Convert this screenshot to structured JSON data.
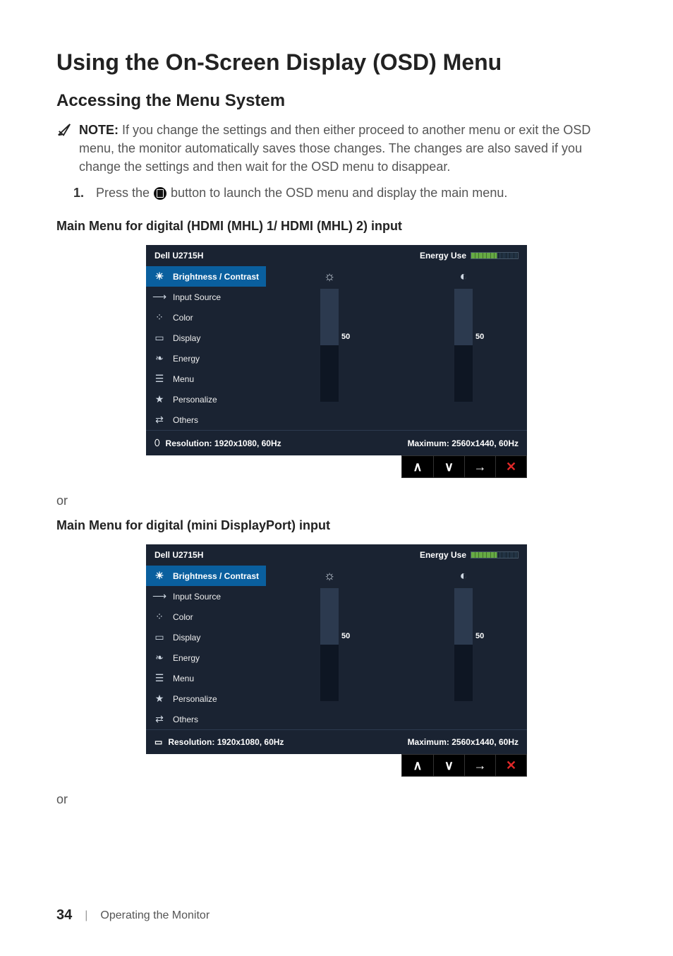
{
  "headings": {
    "h1": "Using the On-Screen Display (OSD) Menu",
    "h2": "Accessing the Menu System",
    "noteLabel": "NOTE:",
    "noteBody": " If you change the settings and then either proceed to another menu or exit the OSD menu, the monitor automatically saves those changes. The changes are also saved if you change the settings and then wait for the OSD menu to disappear.",
    "stepNum": "1.",
    "stepPre": "Press the ",
    "stepPost": " button to launch the OSD menu and display the main menu.",
    "sub1": "Main Menu for digital (HDMI (MHL) 1/ HDMI (MHL) 2) input",
    "or": "or",
    "sub2": "Main Menu for digital (mini DisplayPort) input"
  },
  "osd": {
    "model": "Dell U2715H",
    "energyLabel": "Energy Use",
    "menu": [
      {
        "icon": "☀",
        "label": "Brightness / Contrast",
        "selected": true
      },
      {
        "icon": "⟶",
        "label": "Input Source"
      },
      {
        "icon": "⁘",
        "label": "Color"
      },
      {
        "icon": "▭",
        "label": "Display"
      },
      {
        "icon": "❧",
        "label": "Energy"
      },
      {
        "icon": "☰",
        "label": "Menu"
      },
      {
        "icon": "★",
        "label": "Personalize"
      },
      {
        "icon": "⇄",
        "label": "Others"
      }
    ],
    "brightness": {
      "value": 50,
      "icon": "☼"
    },
    "contrast": {
      "value": 50,
      "icon": "◐"
    },
    "resolutionLabel": "Resolution:",
    "resolution": "1920x1080, 60Hz",
    "maximumLabel": "Maximum:",
    "maximum": "2560x1440, 60Hz",
    "connIconA": "⬯",
    "connIconB": "▭",
    "buttons": {
      "up": "∧",
      "down": "∨",
      "enter": "→",
      "close": "✕"
    }
  },
  "footer": {
    "pageNum": "34",
    "divider": "|",
    "section": "Operating the Monitor"
  }
}
